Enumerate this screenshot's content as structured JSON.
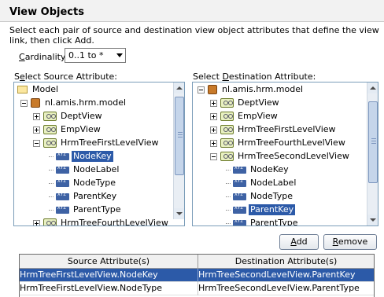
{
  "dialog": {
    "title": "View Objects",
    "instructions": "Select each pair of source and destination view object attributes that define the view link, then click Add."
  },
  "cardinality": {
    "label_pre": "",
    "label_mnemonic": "C",
    "label_post": "ardinality:",
    "value": "0..1 to *"
  },
  "source": {
    "label_pre": "S",
    "label_mnemonic": "e",
    "label_post": "lect Source Attribute:",
    "nodes": [
      {
        "label": "Model",
        "icon": "folder-icon"
      },
      {
        "label": "nl.amis.hrm.model",
        "icon": "package-icon"
      },
      {
        "label": "DeptView",
        "icon": "view-object-icon"
      },
      {
        "label": "EmpView",
        "icon": "view-object-icon"
      },
      {
        "label": "HrmTreeFirstLevelView",
        "icon": "view-object-icon"
      },
      {
        "label": "NodeKey",
        "icon": "attribute-icon",
        "selected": true
      },
      {
        "label": "NodeLabel",
        "icon": "attribute-icon"
      },
      {
        "label": "NodeType",
        "icon": "attribute-icon"
      },
      {
        "label": "ParentKey",
        "icon": "attribute-icon"
      },
      {
        "label": "ParentType",
        "icon": "attribute-icon"
      },
      {
        "label": "HrmTreeFourthLevelView",
        "icon": "view-object-icon"
      }
    ]
  },
  "destination": {
    "label_pre": "Select ",
    "label_mnemonic": "D",
    "label_post": "estination Attribute:",
    "nodes": [
      {
        "label": "nl.amis.hrm.model",
        "icon": "package-icon"
      },
      {
        "label": "DeptView",
        "icon": "view-object-icon"
      },
      {
        "label": "EmpView",
        "icon": "view-object-icon"
      },
      {
        "label": "HrmTreeFirstLevelView",
        "icon": "view-object-icon"
      },
      {
        "label": "HrmTreeFourthLevelView",
        "icon": "view-object-icon"
      },
      {
        "label": "HrmTreeSecondLevelView",
        "icon": "view-object-icon"
      },
      {
        "label": "NodeKey",
        "icon": "attribute-icon"
      },
      {
        "label": "NodeLabel",
        "icon": "attribute-icon"
      },
      {
        "label": "NodeType",
        "icon": "attribute-icon"
      },
      {
        "label": "ParentKey",
        "icon": "attribute-icon",
        "selected": true
      },
      {
        "label": "ParentType",
        "icon": "attribute-icon"
      }
    ]
  },
  "buttons": {
    "add_mnemonic": "A",
    "add_rest": "dd",
    "remove_mnemonic": "R",
    "remove_rest": "emove"
  },
  "table": {
    "headers": [
      "Source Attribute(s)",
      "Destination Attribute(s)"
    ],
    "rows": [
      [
        "HrmTreeFirstLevelView.NodeKey",
        "HrmTreeSecondLevelView.ParentKey"
      ],
      [
        "HrmTreeFirstLevelView.NodeType",
        "HrmTreeSecondLevelView.ParentType"
      ]
    ]
  }
}
